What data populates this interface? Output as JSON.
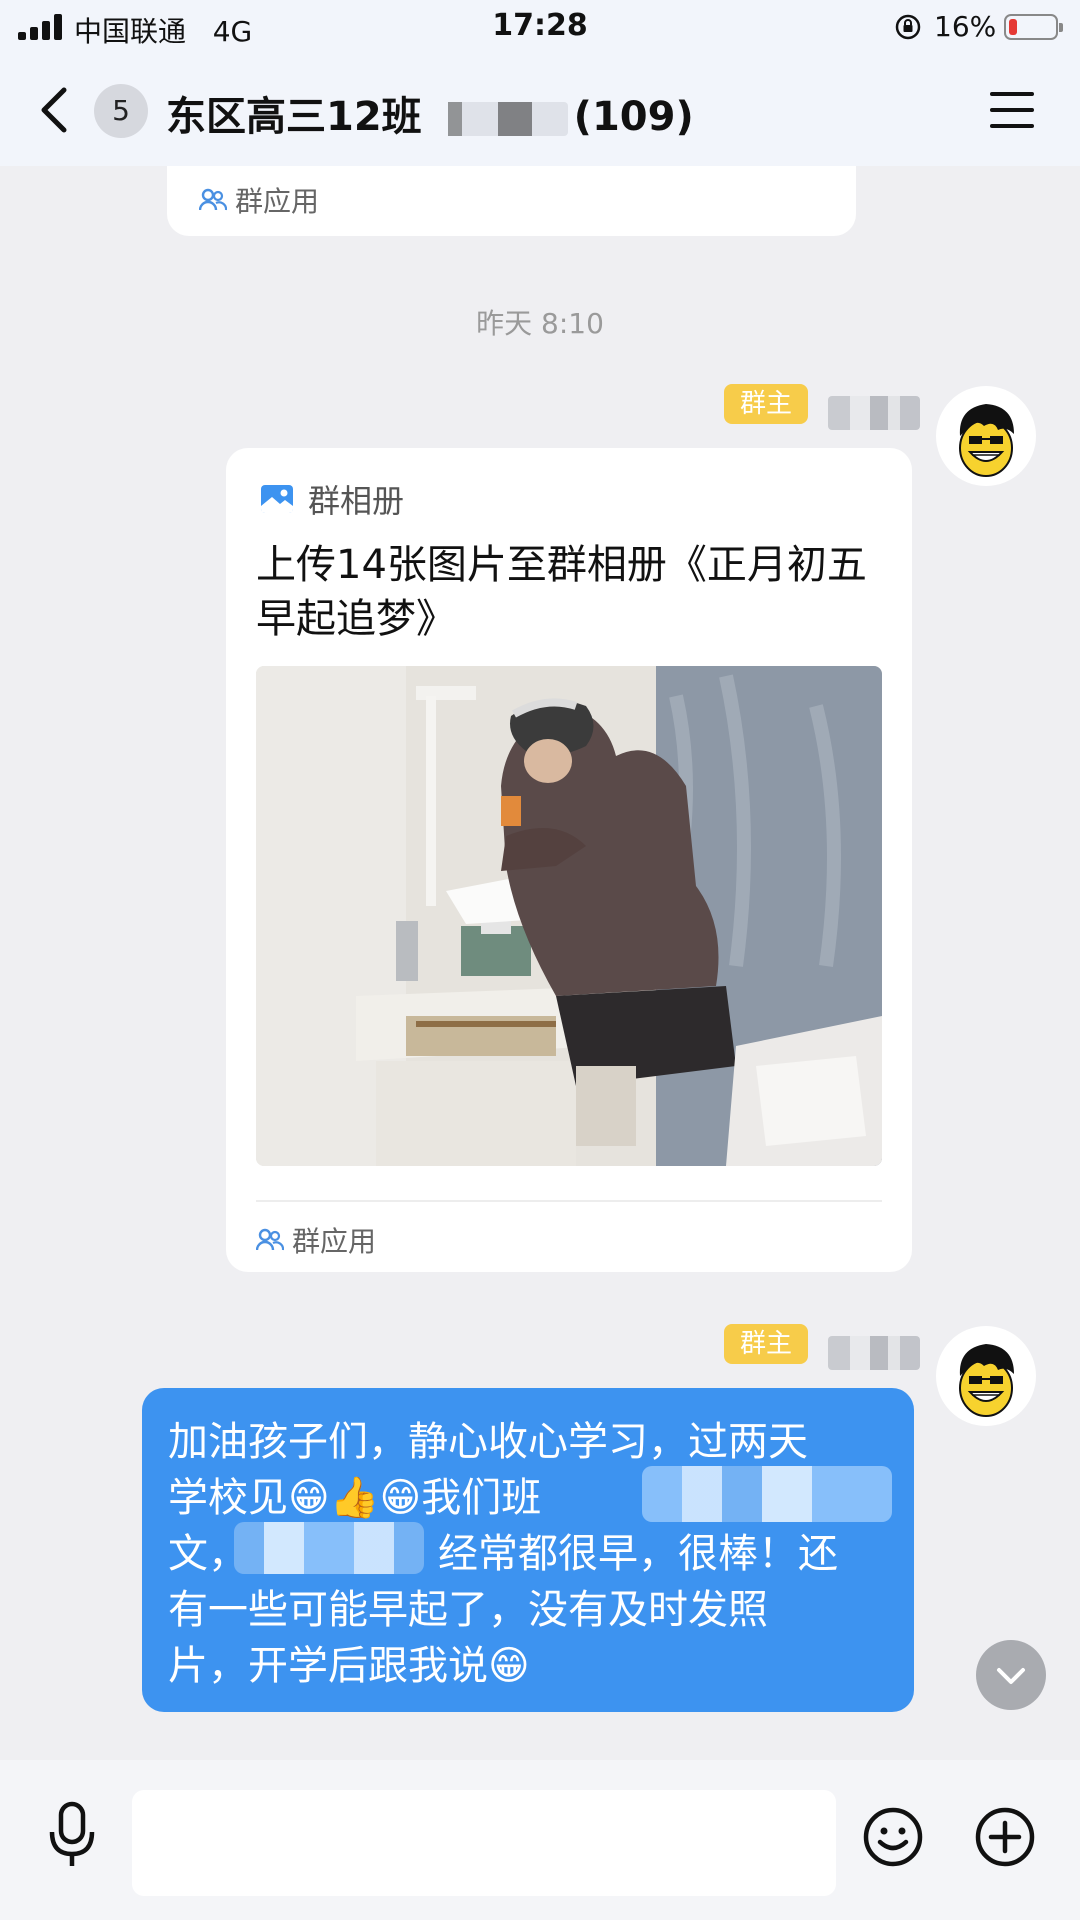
{
  "status_bar": {
    "carrier": "中国联通",
    "network": "4G",
    "time": "17:28",
    "battery": "16%",
    "battery_level": 0.16
  },
  "header": {
    "unread_count": "5",
    "title_prefix": "东区高三12班",
    "title_suffix": "(109)"
  },
  "messages": {
    "prev_card_app_label": "群应用",
    "timestamp": "昨天 8:10",
    "album_message": {
      "badge": "群主",
      "source_label": "群相册",
      "text": "上传14张图片至群相册《正月初五早起追梦》",
      "footer_app_label": "群应用"
    },
    "text_message": {
      "badge": "群主",
      "line1": "加油孩子们，静心收心学习，过两天",
      "line2": "学校见😁👍😁我们班",
      "line3": "文，",
      "line3b": "经常都很早，很棒！还",
      "line4": "有一些可能早起了，没有及时发照",
      "line5": "片，开学后跟我说😁"
    }
  },
  "colors": {
    "bubble": "#3d93f0",
    "owner_badge": "#f7cc4a",
    "background": "#efeff2"
  },
  "icons": [
    "back-arrow-icon",
    "menu-icon",
    "group-app-icon",
    "album-icon",
    "microphone-icon",
    "emoji-icon",
    "plus-icon",
    "chevron-down-icon"
  ]
}
